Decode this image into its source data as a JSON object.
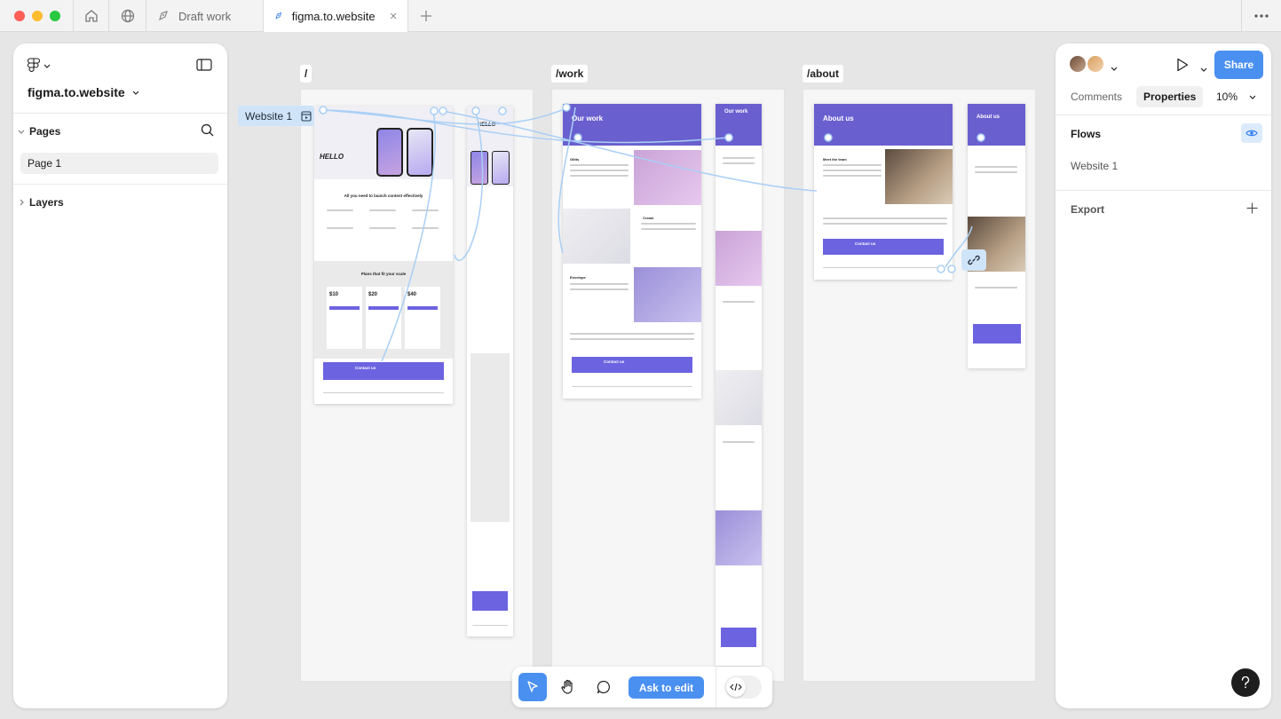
{
  "window": {
    "tabs": [
      {
        "label": "Draft work",
        "active": false
      },
      {
        "label": "figma.to.website",
        "active": true
      }
    ]
  },
  "left_panel": {
    "file_name": "figma.to.website",
    "pages_heading": "Pages",
    "pages": [
      "Page 1"
    ],
    "layers_heading": "Layers"
  },
  "canvas": {
    "flow_tag": "Website 1",
    "frames": [
      {
        "label": "/"
      },
      {
        "label": "/work"
      },
      {
        "label": "/about"
      }
    ],
    "home": {
      "hero_title": "HELLO",
      "headline": "All you need to launch content effectively",
      "pricing_title": "Plans that fit your scale",
      "prices": [
        "$10",
        "$20",
        "$40"
      ],
      "contact": "Contact us"
    },
    "work": {
      "hero_title": "Our work",
      "sections": [
        "Glitts",
        "Cream",
        "Envelope"
      ],
      "contact": "Contact us"
    },
    "about": {
      "hero_title": "About us",
      "team_title": "Meet the team",
      "contact": "Contact us"
    }
  },
  "right_panel": {
    "tabs": [
      "Comments",
      "Properties"
    ],
    "active_tab": "Properties",
    "zoom": "10%",
    "share_label": "Share",
    "flows_heading": "Flows",
    "flows": [
      "Website 1"
    ],
    "export_heading": "Export"
  },
  "toolbar": {
    "ask_to_edit": "Ask to edit"
  },
  "colors": {
    "accent": "#4a90f0",
    "brand_purple": "#6a5fcf",
    "flow_line": "#a9cff5"
  }
}
